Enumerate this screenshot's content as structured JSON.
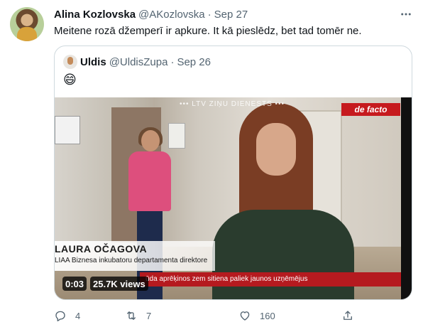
{
  "tweet": {
    "author_name": "Alina Kozlovska",
    "author_handle": "@AKozlovska",
    "separator": "·",
    "date": "Sep 27",
    "text": "Meitene rozā džemperī ir apkure. It kā pieslēdz, bet tad tomēr ne."
  },
  "quoted": {
    "author_name": "Uldis",
    "author_handle": "@UldisZupa",
    "separator": "·",
    "date": "Sep 26",
    "emoji": "😄"
  },
  "video": {
    "watermark": "••• LTV ZIŅU DIENESTS •••",
    "logo": "de facto",
    "lower_third_name": "LAURA OČAGOVA",
    "lower_third_title": "LIAA Biznesa inkubatoru departamenta direktore",
    "ticker": "ūda aprēķinos zem sitiena paliek jaunos uzņēmējus",
    "time": "0:03",
    "views": "25.7K views"
  },
  "actions": {
    "replies": "4",
    "retweets": "7",
    "likes": "160"
  },
  "icons": [
    "more-icon",
    "reply-icon",
    "retweet-icon",
    "like-icon",
    "share-icon"
  ],
  "colors": {
    "text": "#0f1419",
    "secondary": "#536471",
    "border": "#cfd9de",
    "logo_red": "#c61a1e"
  }
}
